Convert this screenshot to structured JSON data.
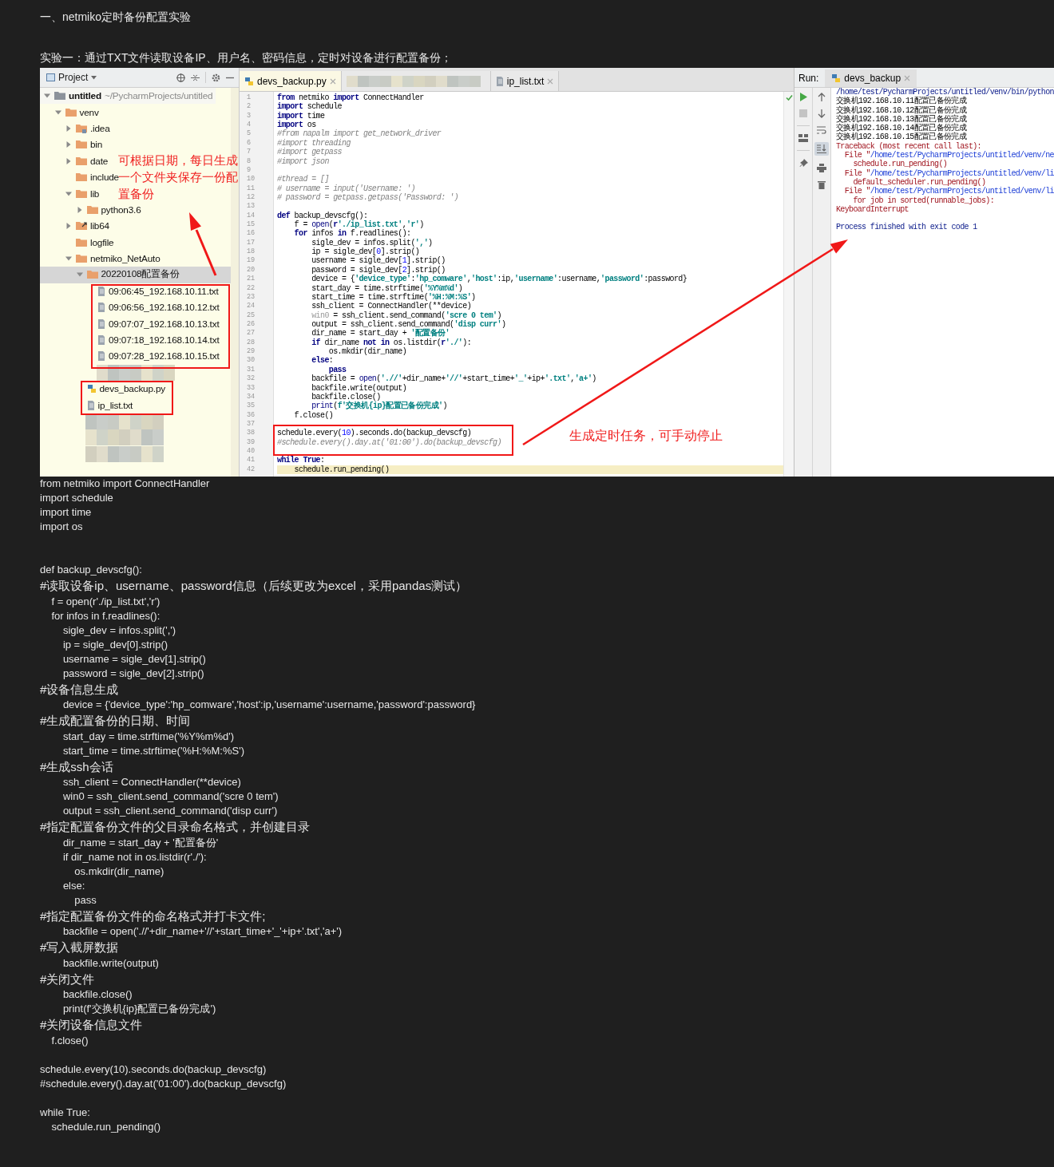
{
  "heading": "一、netmiko定时备份配置实验",
  "intro": "实验一：通过TXT文件读取设备IP、用户名、密码信息，定时对设备进行配置备份；",
  "ide": {
    "project": {
      "title": "Project",
      "tree": [
        {
          "label": "untitled",
          "path": "~/PycharmProjects/untitled",
          "kind": "project",
          "expanded": true,
          "selected": false,
          "children": [
            {
              "label": "venv",
              "kind": "folder",
              "expanded": true,
              "selected": false,
              "children": [
                {
                  "label": ".idea",
                  "kind": "idea-folder",
                  "expanded": false,
                  "selected": false
                },
                {
                  "label": "bin",
                  "kind": "folder",
                  "expanded": false,
                  "selected": false
                },
                {
                  "label": "date",
                  "kind": "folder",
                  "expanded": false,
                  "selected": false
                },
                {
                  "label": "include",
                  "kind": "folder",
                  "selected": false
                },
                {
                  "label": "lib",
                  "kind": "folder",
                  "expanded": true,
                  "selected": false,
                  "children": [
                    {
                      "label": "python3.6",
                      "kind": "folder",
                      "expanded": false,
                      "selected": false
                    }
                  ]
                },
                {
                  "label": "lib64",
                  "kind": "link-folder",
                  "expanded": false,
                  "selected": false
                },
                {
                  "label": "logfile",
                  "kind": "folder",
                  "selected": false
                },
                {
                  "label": "netmiko_NetAuto",
                  "kind": "folder",
                  "expanded": true,
                  "selected": false,
                  "children": [
                    {
                      "label": "20220108配置备份",
                      "kind": "folder",
                      "expanded": true,
                      "selected": true,
                      "children": [
                        {
                          "label": "09:06:45_192.168.10.11.txt",
                          "kind": "text-file",
                          "selected": false
                        },
                        {
                          "label": "09:06:56_192.168.10.12.txt",
                          "kind": "text-file",
                          "selected": false
                        },
                        {
                          "label": "09:07:07_192.168.10.13.txt",
                          "kind": "text-file",
                          "selected": false
                        },
                        {
                          "label": "09:07:18_192.168.10.14.txt",
                          "kind": "text-file",
                          "selected": false
                        },
                        {
                          "label": "09:07:28_192.168.10.15.txt",
                          "kind": "text-file",
                          "selected": false
                        }
                      ]
                    },
                    {
                      "kind": "blurred"
                    },
                    {
                      "label": "devs_backup.py",
                      "kind": "python-file",
                      "selected": false
                    },
                    {
                      "label": "ip_list.txt",
                      "kind": "text-file",
                      "selected": false
                    }
                  ]
                },
                {
                  "kind": "blurred"
                },
                {
                  "kind": "blurred"
                },
                {
                  "kind": "blurred"
                }
              ]
            }
          ]
        }
      ]
    },
    "editor": {
      "tabs": [
        {
          "label": "devs_backup.py",
          "kind": "python",
          "selected": true
        },
        {
          "kind": "blurred",
          "selected": false
        },
        {
          "label": "ip_list.txt",
          "kind": "text",
          "selected": false
        }
      ],
      "lines": [
        {
          "number": "1",
          "current": false,
          "tokens": [
            {
              "kind": "kw",
              "text": "from"
            },
            {
              "kind": "txt",
              "text": " netmiko "
            },
            {
              "kind": "kw",
              "text": "import"
            },
            {
              "kind": "txt",
              "text": " ConnectHandler"
            }
          ]
        },
        {
          "number": "2",
          "current": false,
          "tokens": [
            {
              "kind": "kw",
              "text": "import"
            },
            {
              "kind": "txt",
              "text": " schedule"
            }
          ]
        },
        {
          "number": "3",
          "current": false,
          "tokens": [
            {
              "kind": "kw",
              "text": "import"
            },
            {
              "kind": "txt",
              "text": " time"
            }
          ]
        },
        {
          "number": "4",
          "current": false,
          "tokens": [
            {
              "kind": "kw",
              "text": "import"
            },
            {
              "kind": "txt",
              "text": " os"
            }
          ]
        },
        {
          "number": "5",
          "current": false,
          "tokens": [
            {
              "kind": "com",
              "text": "#from napalm import get_network_driver"
            }
          ]
        },
        {
          "number": "6",
          "current": false,
          "tokens": [
            {
              "kind": "com",
              "text": "#import threading"
            }
          ]
        },
        {
          "number": "7",
          "current": false,
          "tokens": [
            {
              "kind": "com",
              "text": "#import getpass"
            }
          ]
        },
        {
          "number": "8",
          "current": false,
          "tokens": [
            {
              "kind": "com",
              "text": "#import json"
            }
          ]
        },
        {
          "number": "9",
          "current": false
        },
        {
          "number": "10",
          "current": false,
          "tokens": [
            {
              "kind": "com",
              "text": "#thread = []"
            }
          ]
        },
        {
          "number": "11",
          "current": false,
          "tokens": [
            {
              "kind": "com",
              "text": "# username = input('Username: ')"
            }
          ]
        },
        {
          "number": "12",
          "current": false,
          "tokens": [
            {
              "kind": "com",
              "text": "# password = getpass.getpass('Password: ')"
            }
          ]
        },
        {
          "number": "13",
          "current": false
        },
        {
          "number": "14",
          "current": false,
          "tokens": [
            {
              "kind": "kw",
              "text": "def"
            },
            {
              "kind": "txt",
              "text": " backup_devscfg():"
            }
          ]
        },
        {
          "number": "15",
          "current": false,
          "tokens": [
            {
              "kind": "txt",
              "text": "    f = "
            },
            {
              "kind": "fn",
              "text": "open"
            },
            {
              "kind": "txt",
              "text": "("
            },
            {
              "kind": "kw",
              "text": "r"
            },
            {
              "kind": "str",
              "text": "'./ip_list.txt'"
            },
            {
              "kind": "txt",
              "text": ","
            },
            {
              "kind": "str",
              "text": "'r'"
            },
            {
              "kind": "txt",
              "text": ")"
            }
          ]
        },
        {
          "number": "16",
          "current": false,
          "tokens": [
            {
              "kind": "kw",
              "text": "    for"
            },
            {
              "kind": "txt",
              "text": " infos "
            },
            {
              "kind": "kw",
              "text": "in"
            },
            {
              "kind": "txt",
              "text": " f.readlines():"
            }
          ]
        },
        {
          "number": "17",
          "current": false,
          "tokens": [
            {
              "kind": "txt",
              "text": "        sigle_dev = infos.split("
            },
            {
              "kind": "str",
              "text": "','"
            },
            {
              "kind": "txt",
              "text": ")"
            }
          ]
        },
        {
          "number": "18",
          "current": false,
          "tokens": [
            {
              "kind": "txt",
              "text": "        ip = sigle_dev["
            },
            {
              "kind": "num",
              "text": "0"
            },
            {
              "kind": "txt",
              "text": "].strip()"
            }
          ]
        },
        {
          "number": "19",
          "current": false,
          "tokens": [
            {
              "kind": "txt",
              "text": "        username = sigle_dev["
            },
            {
              "kind": "num",
              "text": "1"
            },
            {
              "kind": "txt",
              "text": "].strip()"
            }
          ]
        },
        {
          "number": "20",
          "current": false,
          "tokens": [
            {
              "kind": "txt",
              "text": "        password = sigle_dev["
            },
            {
              "kind": "num",
              "text": "2"
            },
            {
              "kind": "txt",
              "text": "].strip()"
            }
          ]
        },
        {
          "number": "21",
          "current": false,
          "tokens": [
            {
              "kind": "txt",
              "text": "        device = {"
            },
            {
              "kind": "str",
              "text": "'device_type'"
            },
            {
              "kind": "txt",
              "text": ":"
            },
            {
              "kind": "str",
              "text": "'hp_comware'"
            },
            {
              "kind": "txt",
              "text": ","
            },
            {
              "kind": "str",
              "text": "'host'"
            },
            {
              "kind": "txt",
              "text": ":ip,"
            },
            {
              "kind": "str",
              "text": "'username'"
            },
            {
              "kind": "txt",
              "text": ":username,"
            },
            {
              "kind": "str",
              "text": "'password'"
            },
            {
              "kind": "txt",
              "text": ":password}"
            }
          ]
        },
        {
          "number": "22",
          "current": false,
          "tokens": [
            {
              "kind": "txt",
              "text": "        start_day = time.strftime("
            },
            {
              "kind": "str",
              "text": "'%Y%m%d'"
            },
            {
              "kind": "txt",
              "text": ")"
            }
          ]
        },
        {
          "number": "23",
          "current": false,
          "tokens": [
            {
              "kind": "txt",
              "text": "        start_time = time.strftime("
            },
            {
              "kind": "str",
              "text": "'%H:%M:%S'"
            },
            {
              "kind": "txt",
              "text": ")"
            }
          ]
        },
        {
          "number": "24",
          "current": false,
          "tokens": [
            {
              "kind": "txt",
              "text": "        ssh_client = ConnectHandler(**device)"
            }
          ]
        },
        {
          "number": "25",
          "current": false,
          "tokens": [
            {
              "kind": "dim",
              "text": "        win0"
            },
            {
              "kind": "txt",
              "text": " = ssh_client.send_command("
            },
            {
              "kind": "str",
              "text": "'scre 0 tem'"
            },
            {
              "kind": "txt",
              "text": ")"
            }
          ]
        },
        {
          "number": "26",
          "current": false,
          "tokens": [
            {
              "kind": "txt",
              "text": "        output = ssh_client.send_command("
            },
            {
              "kind": "str",
              "text": "'disp curr'"
            },
            {
              "kind": "txt",
              "text": ")"
            }
          ]
        },
        {
          "number": "27",
          "current": false,
          "tokens": [
            {
              "kind": "txt",
              "text": "        dir_name = start_day + "
            },
            {
              "kind": "str",
              "text": "'配置备份'"
            }
          ]
        },
        {
          "number": "28",
          "current": false,
          "tokens": [
            {
              "kind": "kw",
              "text": "        if"
            },
            {
              "kind": "txt",
              "text": " dir_name "
            },
            {
              "kind": "kw",
              "text": "not in"
            },
            {
              "kind": "txt",
              "text": " os.listdir("
            },
            {
              "kind": "kw",
              "text": "r"
            },
            {
              "kind": "str",
              "text": "'./'"
            },
            {
              "kind": "txt",
              "text": "):"
            }
          ]
        },
        {
          "number": "29",
          "current": false,
          "tokens": [
            {
              "kind": "txt",
              "text": "            os.mkdir(dir_name)"
            }
          ]
        },
        {
          "number": "30",
          "current": false,
          "tokens": [
            {
              "kind": "kw",
              "text": "        else"
            },
            {
              "kind": "txt",
              "text": ":"
            }
          ]
        },
        {
          "number": "31",
          "current": false,
          "tokens": [
            {
              "kind": "kw",
              "text": "            pass"
            }
          ]
        },
        {
          "number": "32",
          "current": false,
          "tokens": [
            {
              "kind": "txt",
              "text": "        backfile = "
            },
            {
              "kind": "fn",
              "text": "open"
            },
            {
              "kind": "txt",
              "text": "("
            },
            {
              "kind": "str",
              "text": "'.//'"
            },
            {
              "kind": "txt",
              "text": "+dir_name+"
            },
            {
              "kind": "str",
              "text": "'//'"
            },
            {
              "kind": "txt",
              "text": "+start_time+"
            },
            {
              "kind": "str",
              "text": "'_'"
            },
            {
              "kind": "txt",
              "text": "+ip+"
            },
            {
              "kind": "str",
              "text": "'.txt'"
            },
            {
              "kind": "txt",
              "text": ","
            },
            {
              "kind": "str",
              "text": "'a+'"
            },
            {
              "kind": "txt",
              "text": ")"
            }
          ]
        },
        {
          "number": "33",
          "current": false,
          "tokens": [
            {
              "kind": "txt",
              "text": "        backfile.write(output)"
            }
          ]
        },
        {
          "number": "34",
          "current": false,
          "tokens": [
            {
              "kind": "txt",
              "text": "        backfile.close()"
            }
          ]
        },
        {
          "number": "35",
          "current": false,
          "tokens": [
            {
              "kind": "fn",
              "text": "        print"
            },
            {
              "kind": "txt",
              "text": "("
            },
            {
              "kind": "str",
              "text": "f'交换机{ip}配置已备份完成'"
            },
            {
              "kind": "txt",
              "text": ")"
            }
          ]
        },
        {
          "number": "36",
          "current": false,
          "tokens": [
            {
              "kind": "txt",
              "text": "    f.close()"
            }
          ]
        },
        {
          "number": "37",
          "current": false
        },
        {
          "number": "38",
          "current": false,
          "tokens": [
            {
              "kind": "txt",
              "text": "schedule.every("
            },
            {
              "kind": "num",
              "text": "10"
            },
            {
              "kind": "txt",
              "text": ").seconds.do(backup_devscfg)"
            }
          ]
        },
        {
          "number": "39",
          "current": false,
          "tokens": [
            {
              "kind": "com",
              "text": "#schedule.every().day.at('01:00').do(backup_devscfg)"
            }
          ]
        },
        {
          "number": "40",
          "current": false
        },
        {
          "number": "41",
          "current": false,
          "tokens": [
            {
              "kind": "kw",
              "text": "while"
            },
            {
              "kind": "kw",
              "text": " True"
            },
            {
              "kind": "txt",
              "text": ":"
            }
          ]
        },
        {
          "number": "42",
          "current": true,
          "tokens": [
            {
              "kind": "txt",
              "text": "    schedule.run_pending()"
            }
          ]
        }
      ]
    },
    "run": {
      "label": "Run:",
      "tab": "devs_backup",
      "scroll_to_end_on": true,
      "output": [
        {
          "segments": [
            {
              "kind": "path",
              "text": "/home/test/PycharmProjects/untitled/venv/bin/python"
            }
          ]
        },
        {
          "segments": [
            {
              "kind": "out",
              "text": "交换机192.168.10.11配置已备份完成"
            }
          ]
        },
        {
          "segments": [
            {
              "kind": "out",
              "text": "交换机192.168.10.12配置已备份完成"
            }
          ]
        },
        {
          "segments": [
            {
              "kind": "out",
              "text": "交换机192.168.10.13配置已备份完成"
            }
          ]
        },
        {
          "segments": [
            {
              "kind": "out",
              "text": "交换机192.168.10.14配置已备份完成"
            }
          ]
        },
        {
          "segments": [
            {
              "kind": "out",
              "text": "交换机192.168.10.15配置已备份完成"
            }
          ]
        },
        {
          "segments": [
            {
              "kind": "err",
              "text": "Traceback (most recent call last):"
            }
          ]
        },
        {
          "segments": [
            {
              "kind": "err",
              "text": "  File \""
            },
            {
              "kind": "link",
              "text": "/home/test/PycharmProjects/untitled/venv/ne"
            }
          ]
        },
        {
          "segments": [
            {
              "kind": "err",
              "text": "    schedule.run_pending()"
            }
          ]
        },
        {
          "segments": [
            {
              "kind": "err",
              "text": "  File \""
            },
            {
              "kind": "link",
              "text": "/home/test/PycharmProjects/untitled/venv/li"
            }
          ]
        },
        {
          "segments": [
            {
              "kind": "err",
              "text": "    default_scheduler.run_pending()"
            }
          ]
        },
        {
          "segments": [
            {
              "kind": "err",
              "text": "  File \""
            },
            {
              "kind": "link",
              "text": "/home/test/PycharmProjects/untitled/venv/li"
            }
          ]
        },
        {
          "segments": [
            {
              "kind": "err",
              "text": "    for job in sorted(runnable_jobs):"
            }
          ]
        },
        {
          "segments": [
            {
              "kind": "err",
              "text": "KeyboardInterrupt"
            }
          ]
        },
        {
          "gap_before": true,
          "segments": [
            {
              "kind": "path",
              "text": "Process finished with exit code 1"
            }
          ]
        }
      ]
    },
    "notes": [
      "可根据日期，每日生成一个文件夹保存一份配置备份",
      "生成定时任务，可手动停止"
    ]
  },
  "code_lines": [
    {
      "kind": "code",
      "text": "from netmiko import ConnectHandler"
    },
    {
      "kind": "code",
      "text": "import schedule"
    },
    {
      "kind": "code",
      "text": "import time"
    },
    {
      "kind": "code",
      "text": "import os"
    },
    {
      "kind": "blank"
    },
    {
      "kind": "blank"
    },
    {
      "kind": "code",
      "text": "def backup_devscfg():"
    },
    {
      "kind": "comment",
      "text": "#读取设备ip、username、password信息（后续更改为excel，采用pandas测试）"
    },
    {
      "kind": "code",
      "text": "    f = open(r'./ip_list.txt','r')"
    },
    {
      "kind": "code",
      "text": "    for infos in f.readlines():"
    },
    {
      "kind": "code",
      "text": "        sigle_dev = infos.split(',')"
    },
    {
      "kind": "code",
      "text": "        ip = sigle_dev[0].strip()"
    },
    {
      "kind": "code",
      "text": "        username = sigle_dev[1].strip()"
    },
    {
      "kind": "code",
      "text": "        password = sigle_dev[2].strip()"
    },
    {
      "kind": "comment",
      "text": "#设备信息生成"
    },
    {
      "kind": "code",
      "text": "        device = {'device_type':'hp_comware','host':ip,'username':username,'password':password}"
    },
    {
      "kind": "comment",
      "text": "#生成配置备份的日期、时间"
    },
    {
      "kind": "code",
      "text": "        start_day = time.strftime('%Y%m%d')"
    },
    {
      "kind": "code",
      "text": "        start_time = time.strftime('%H:%M:%S')"
    },
    {
      "kind": "comment",
      "text": "#生成ssh会话"
    },
    {
      "kind": "code",
      "text": "        ssh_client = ConnectHandler(**device)"
    },
    {
      "kind": "code",
      "text": "        win0 = ssh_client.send_command('scre 0 tem')"
    },
    {
      "kind": "code",
      "text": "        output = ssh_client.send_command('disp curr')"
    },
    {
      "kind": "comment",
      "text": "#指定配置备份文件的父目录命名格式，并创建目录"
    },
    {
      "kind": "code",
      "text": "        dir_name = start_day + '配置备份'"
    },
    {
      "kind": "code",
      "text": "        if dir_name not in os.listdir(r'./'):"
    },
    {
      "kind": "code",
      "text": "            os.mkdir(dir_name)"
    },
    {
      "kind": "code",
      "text": "        else:"
    },
    {
      "kind": "code",
      "text": "            pass"
    },
    {
      "kind": "comment",
      "text": "#指定配置备份文件的命名格式并打卡文件;"
    },
    {
      "kind": "code",
      "text": "        backfile = open('.//'+dir_name+'//'+start_time+'_'+ip+'.txt','a+')"
    },
    {
      "kind": "comment",
      "text": "#写入截屏数据"
    },
    {
      "kind": "code",
      "text": "        backfile.write(output)"
    },
    {
      "kind": "comment",
      "text": "#关闭文件"
    },
    {
      "kind": "code",
      "text": "        backfile.close()"
    },
    {
      "kind": "code",
      "text": "        print(f'交换机{ip}配置已备份完成')"
    },
    {
      "kind": "comment",
      "text": "#关闭设备信息文件"
    },
    {
      "kind": "code",
      "text": "    f.close()"
    },
    {
      "kind": "blank"
    },
    {
      "kind": "code",
      "text": "schedule.every(10).seconds.do(backup_devscfg)"
    },
    {
      "kind": "code",
      "text": "#schedule.every().day.at('01:00').do(backup_devscfg)"
    },
    {
      "kind": "blank"
    },
    {
      "kind": "code",
      "text": "while True:"
    },
    {
      "kind": "code",
      "text": "    schedule.run_pending()"
    }
  ]
}
